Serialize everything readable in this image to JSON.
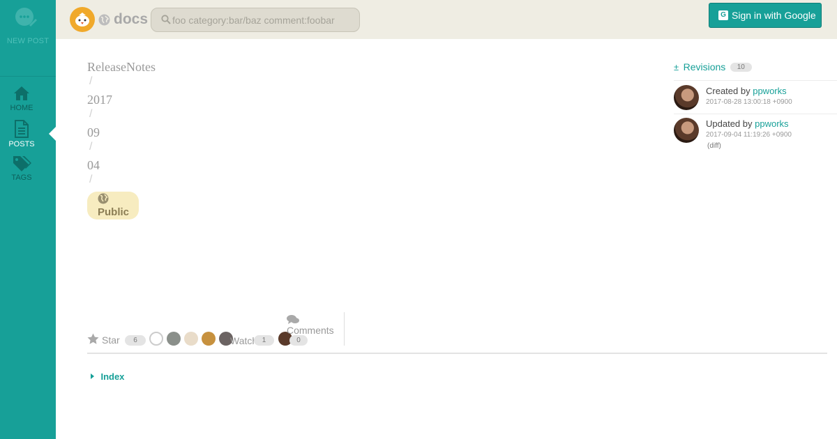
{
  "sidebar": {
    "new_post_label": "NEW POST",
    "items": [
      {
        "label": "HOME",
        "icon": "home-icon"
      },
      {
        "label": "POSTS",
        "icon": "document-icon"
      },
      {
        "label": "TAGS",
        "icon": "tags-icon"
      }
    ],
    "active": "POSTS"
  },
  "header": {
    "site_title": "docs",
    "search_placeholder": "foo category:bar/baz comment:foobar",
    "signin_label": "Sign in with Google"
  },
  "breadcrumb": [
    "ReleaseNotes",
    "2017",
    "09",
    "04"
  ],
  "visibility": "Public",
  "revisions": {
    "label": "Revisions",
    "count": "10",
    "created": {
      "prefix": "Created by",
      "user": "ppworks",
      "time": "2017-08-28 13:00:18 +0900"
    },
    "updated": {
      "prefix": "Updated by",
      "user": "ppworks",
      "time": "2017-09-04 11:19:26 +0900",
      "diff_label": "(diff)"
    }
  },
  "actions": {
    "star_label": "Star",
    "star_count": "6",
    "watch_label": "Watch",
    "watch_count": "1",
    "comments_label": "Comments",
    "comments_count": "0"
  },
  "index_label": "Index",
  "colors": {
    "accent": "#17a098",
    "header_bg": "#efede3",
    "badge_bg": "#f7ecc0"
  }
}
